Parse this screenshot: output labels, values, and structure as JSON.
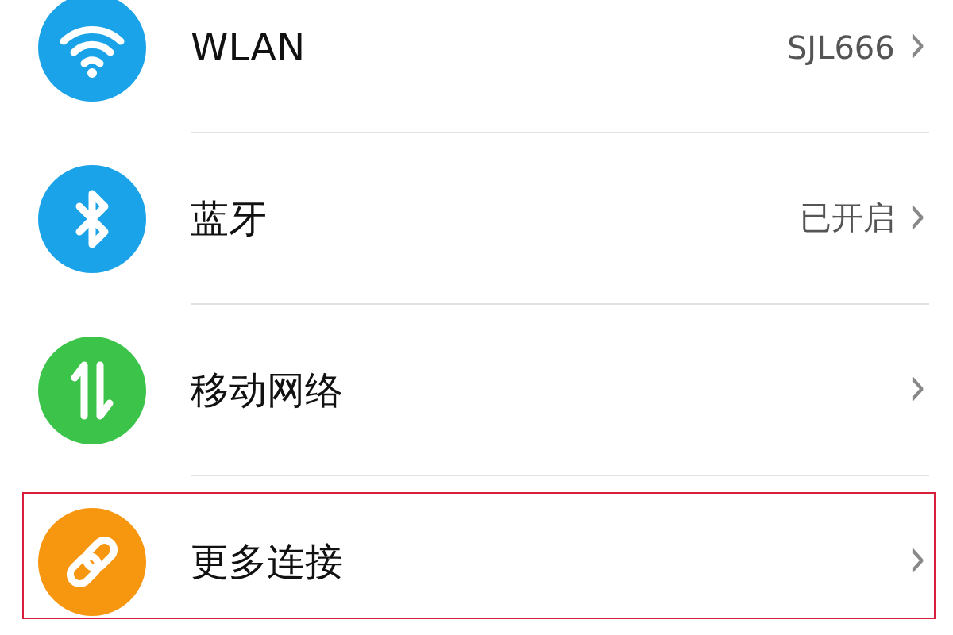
{
  "settings_items": [
    {
      "kind": "wifi",
      "color": "#1aa3e8",
      "label": "WLAN",
      "value": "SJL666",
      "chevron": "›",
      "highlighted": false
    },
    {
      "kind": "bluetooth",
      "color": "#1aa3e8",
      "label": "蓝牙",
      "value": "已开启",
      "chevron": "›",
      "highlighted": false
    },
    {
      "kind": "mobile-data",
      "color": "#3cc44a",
      "label": "移动网络",
      "chevron": "›",
      "highlighted": false
    },
    {
      "kind": "link",
      "color": "#f7960f",
      "label": "更多连接",
      "chevron": "›",
      "highlighted": true
    }
  ]
}
